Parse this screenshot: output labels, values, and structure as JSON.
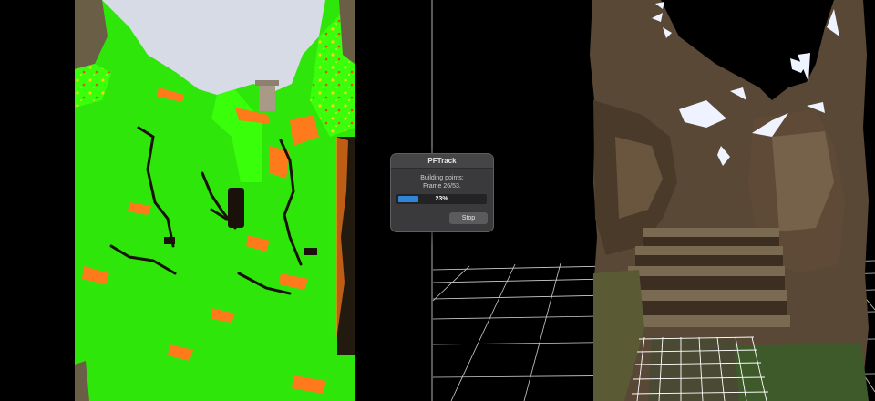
{
  "dialog": {
    "title": "PFTrack",
    "message_line1": "Building points:",
    "message_line2": "Frame 26/53.",
    "progress_label": "23%",
    "progress_fraction": 0.23,
    "stop_label": "Stop"
  },
  "colors": {
    "confidence_high": "#33ff00",
    "confidence_mid": "#ff7a1a",
    "confidence_low": "#c0281c",
    "sky": "#d7dbe6",
    "grid_line": "#d8d8d8",
    "progress_fill": "#2f86d8",
    "dialog_bg": "#3a3a3c"
  }
}
